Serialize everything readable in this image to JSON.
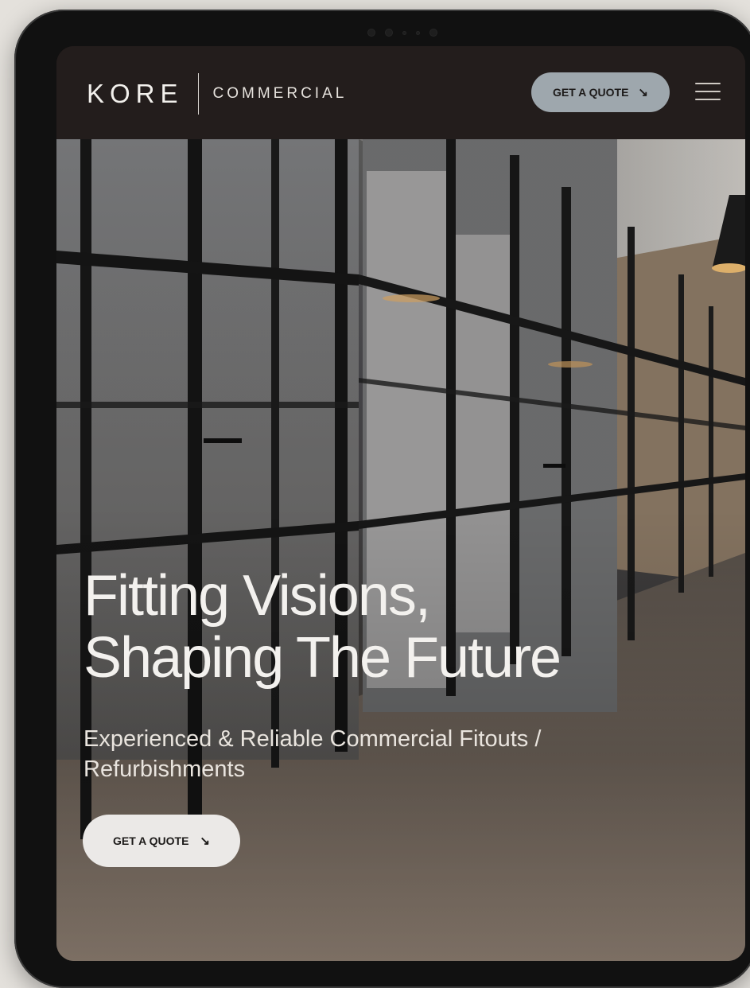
{
  "brand": {
    "logo_text": "KORE",
    "logo_sub": "COMMERCIAL"
  },
  "nav": {
    "cta_label": "GET A QUOTE",
    "cta_icon": "arrow-down-right-icon",
    "menu_icon": "hamburger-menu-icon"
  },
  "hero": {
    "headline_line1": "Fitting Visions,",
    "headline_line2": "Shaping The Future",
    "subline": "Experienced & Reliable Commercial Fitouts / Refurbishments",
    "cta_label": "GET A QUOTE",
    "cta_icon": "arrow-down-right-icon",
    "arrow_glyph": "↘"
  },
  "colors": {
    "nav_bg": "#231d1c",
    "nav_cta_bg": "#9ea7ad",
    "hero_cta_bg": "#ebe9e7",
    "text_light": "#f3f1ee"
  }
}
